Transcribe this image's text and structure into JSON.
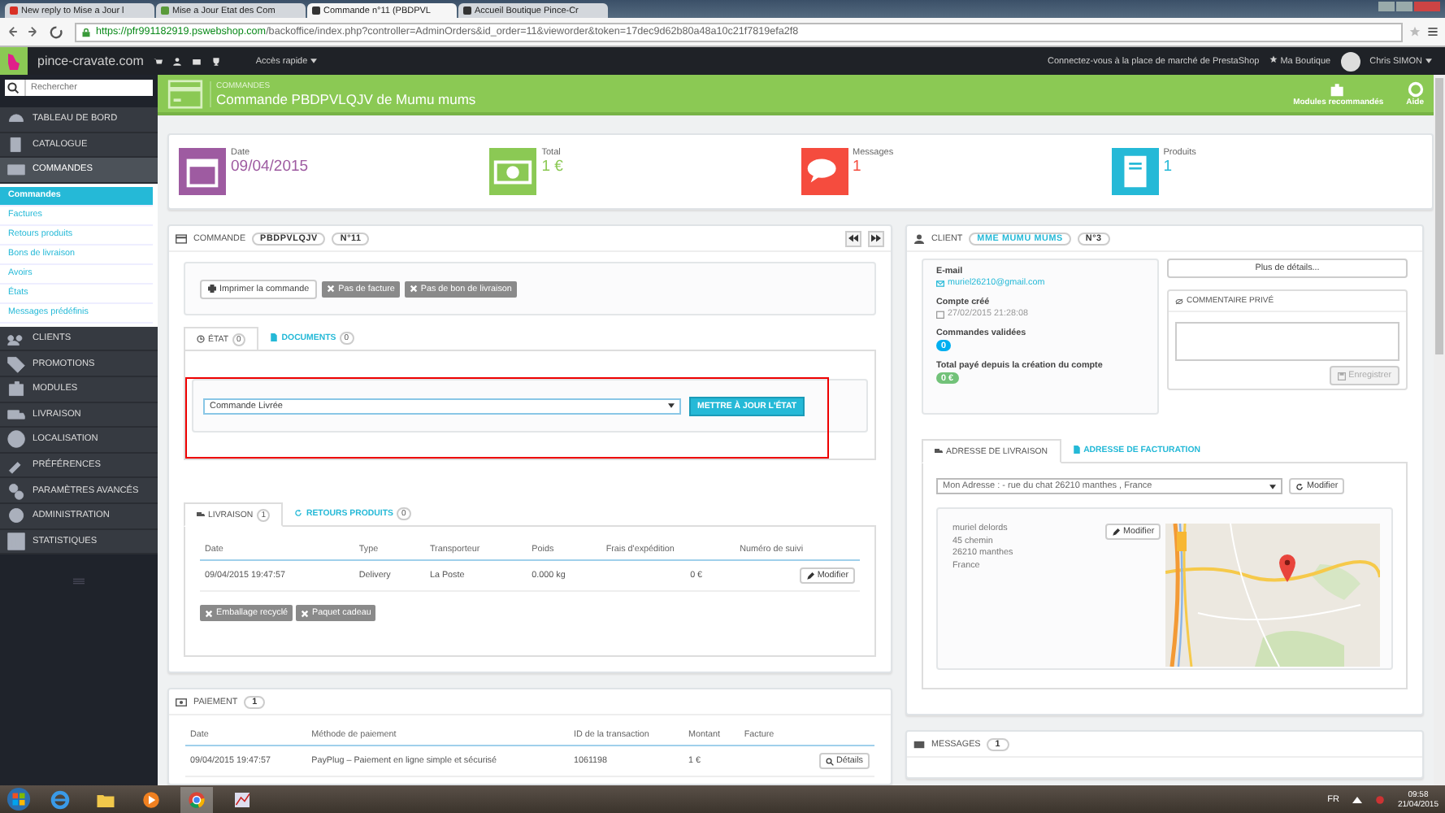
{
  "browser": {
    "tabs": [
      {
        "title": "New reply to Mise a Jour l",
        "kind": "mail",
        "selected": false
      },
      {
        "title": "Mise a Jour Etat des Com",
        "kind": "shop",
        "selected": false
      },
      {
        "title": "Commande n°11 (PBDPVL",
        "kind": "prestashop",
        "selected": true
      },
      {
        "title": "Accueil Boutique Pince-Cr",
        "kind": "prestashop",
        "selected": false
      }
    ],
    "address": {
      "host": "https://pfr991182919.pswebshop.com",
      "path": "/backoffice/index.php?controller=AdminOrders&id_order=11&vieworder&token=17dec9d62b80a48a10c21f7819efa2f8"
    }
  },
  "topbar": {
    "shop": "pince-cravate.com",
    "quick_access": "Accès rapide",
    "marketplace": "Connectez-vous à la place de marché de PrestaShop",
    "my_shop": "Ma Boutique",
    "user": "Chris SIMON"
  },
  "search": {
    "placeholder": "Rechercher"
  },
  "sidebar": {
    "items": [
      {
        "label": "TABLEAU DE BORD",
        "selected": false
      },
      {
        "label": "CATALOGUE",
        "selected": false
      },
      {
        "label": "COMMANDES",
        "selected": true,
        "children": [
          {
            "label": "Commandes",
            "selected": true
          },
          {
            "label": "Factures",
            "selected": false
          },
          {
            "label": "Retours produits",
            "selected": false
          },
          {
            "label": "Bons de livraison",
            "selected": false
          },
          {
            "label": "Avoirs",
            "selected": false
          },
          {
            "label": "États",
            "selected": false
          },
          {
            "label": "Messages prédéfinis",
            "selected": false
          }
        ]
      },
      {
        "label": "CLIENTS",
        "selected": false
      },
      {
        "label": "PROMOTIONS",
        "selected": false
      },
      {
        "label": "MODULES",
        "selected": false
      },
      {
        "label": "LIVRAISON",
        "selected": false
      },
      {
        "label": "LOCALISATION",
        "selected": false
      },
      {
        "label": "PRÉFÉRENCES",
        "selected": false
      },
      {
        "label": "PARAMÈTRES AVANCÉS",
        "selected": false
      },
      {
        "label": "ADMINISTRATION",
        "selected": false
      },
      {
        "label": "STATISTIQUES",
        "selected": false
      }
    ]
  },
  "header": {
    "breadcrumb": "COMMANDES",
    "title": "Commande PBDPVLQJV de Mumu mums",
    "actions": [
      "Modules recommandés",
      "Aide"
    ]
  },
  "kpis": [
    {
      "label": "Date",
      "value": "09/04/2015",
      "color": "#9e5ba1"
    },
    {
      "label": "Total",
      "value": "1 €",
      "color": "#8bc954"
    },
    {
      "label": "Messages",
      "value": "1",
      "color": "#f54c3e"
    },
    {
      "label": "Produits",
      "value": "1",
      "color": "#25b9d7"
    }
  ],
  "order": {
    "title": "COMMANDE",
    "reference": "PBDPVLQJV",
    "number": "N°11",
    "buttons": [
      {
        "label": "Imprimer la commande",
        "kind": "print"
      },
      {
        "label": "Pas de facture",
        "kind": "unavailable"
      },
      {
        "label": "Pas de bon de livraison",
        "kind": "unavailable"
      }
    ],
    "tabs": [
      {
        "label": "ÉTAT",
        "count": "0",
        "selected": true
      },
      {
        "label": "DOCUMENTS",
        "count": "0",
        "selected": false
      }
    ],
    "status_select": "Commande Livrée",
    "update_button": "METTRE À JOUR L'ÉTAT",
    "shipping_tabs": [
      {
        "label": "LIVRAISON",
        "count": "1",
        "selected": true
      },
      {
        "label": "RETOURS PRODUITS",
        "count": "0",
        "selected": false
      }
    ],
    "shipping_table": {
      "columns": [
        "Date",
        "Type",
        "Transporteur",
        "Poids",
        "Frais d'expédition",
        "Numéro de suivi"
      ],
      "rows": [
        {
          "cells": [
            "09/04/2015 19:47:57",
            "Delivery",
            "La Poste",
            "0.000 kg",
            "0 €"
          ],
          "action": "Modifier"
        }
      ]
    },
    "options": [
      "Emballage recyclé",
      "Paquet cadeau"
    ]
  },
  "payment": {
    "title": "PAIEMENT",
    "count": "1",
    "columns": [
      "Date",
      "Méthode de paiement",
      "ID de la transaction",
      "Montant",
      "Facture"
    ],
    "rows": [
      {
        "cells": [
          "09/04/2015 19:47:57",
          "PayPlug – Paiement en ligne simple et sécurisé",
          "1061198",
          "1 €"
        ],
        "action": "Détails"
      }
    ]
  },
  "client": {
    "title": "CLIENT",
    "name": "MME MUMU MUMS",
    "number": "N°3",
    "fields": [
      {
        "label": "E-mail",
        "value": "muriel26210@gmail.com",
        "kind": "email"
      },
      {
        "label": "Compte créé",
        "value": "27/02/2015 21:28:08",
        "kind": "date"
      },
      {
        "label": "Commandes validées",
        "value": "0",
        "kind": "badge",
        "color": "#00aff0"
      },
      {
        "label": "Total payé depuis la création du compte",
        "value": "0 €",
        "kind": "badge",
        "color": "#72c279"
      }
    ],
    "more_button": "Plus de détails...",
    "note": {
      "title": "COMMENTAIRE PRIVÉ",
      "save_button": "Enregistrer"
    }
  },
  "address": {
    "tabs": [
      {
        "label": "ADRESSE DE LIVRAISON",
        "selected": true
      },
      {
        "label": "ADRESSE DE FACTURATION",
        "selected": false
      }
    ],
    "select": "Mon Adresse : - rue du chat 26210 manthes , France",
    "modify_button": "Modifier",
    "lines": [
      "muriel delords",
      "45 chemin",
      "26210 manthes",
      "France"
    ],
    "edit_button": "Modifier"
  },
  "messages": {
    "title": "MESSAGES",
    "count": "1"
  },
  "taskbar": {
    "lang": "FR",
    "time": "09:58",
    "date": "21/04/2015"
  }
}
